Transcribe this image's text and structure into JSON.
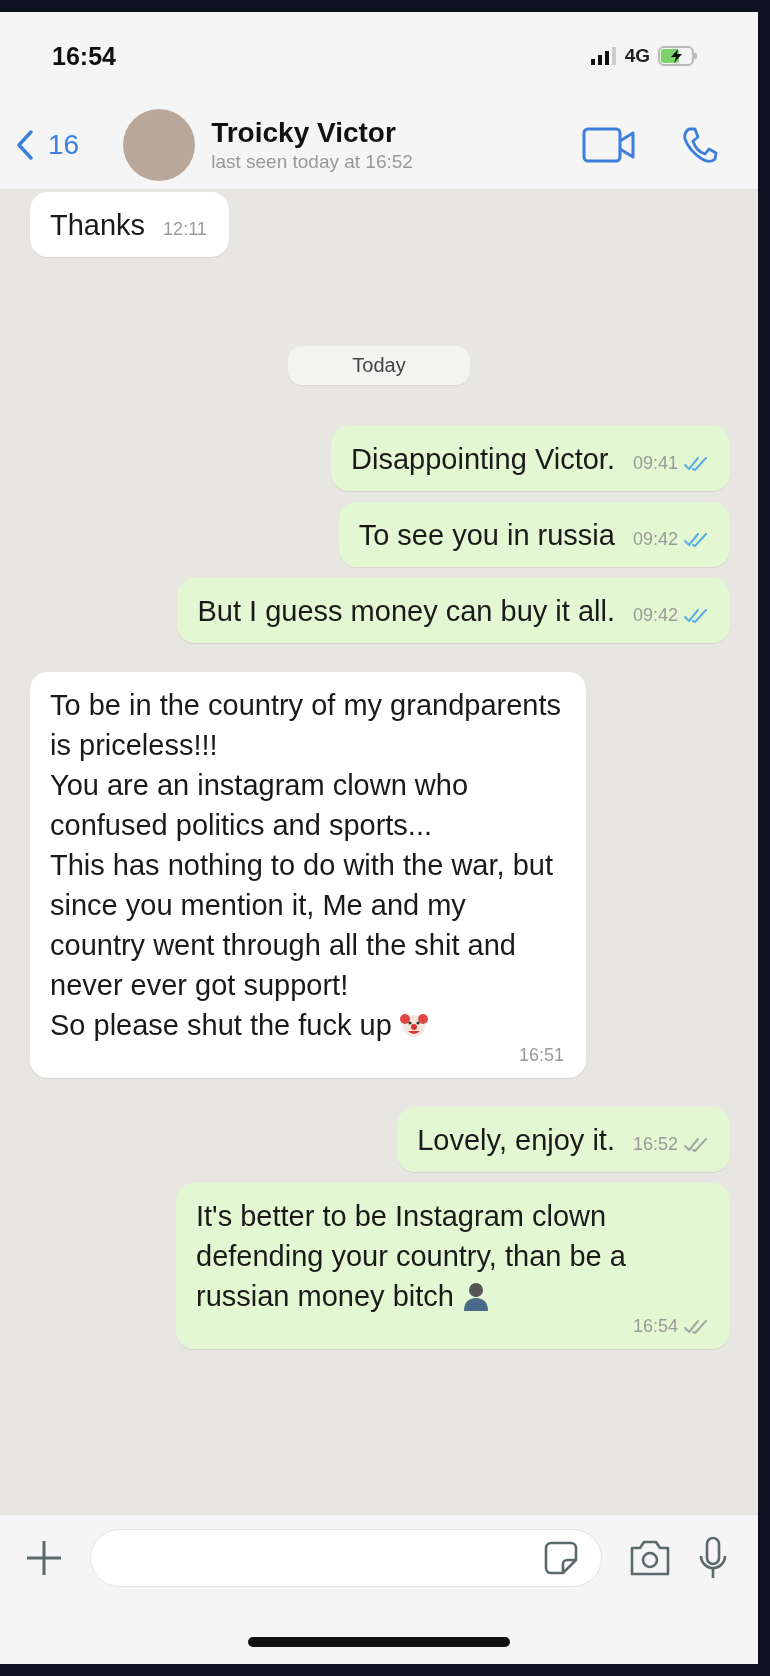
{
  "status_bar": {
    "time": "16:54",
    "network": "4G"
  },
  "header": {
    "back_count": "16",
    "contact_name": "Troicky Victor",
    "last_seen": "last seen today at 16:52"
  },
  "messages": [
    {
      "kind": "incoming",
      "text": "Thanks",
      "time": "12:11"
    },
    {
      "kind": "date",
      "text": "Today"
    },
    {
      "kind": "outgoing",
      "text": "Disappointing Victor.",
      "time": "09:41",
      "read": true
    },
    {
      "kind": "outgoing",
      "text": "To see you in russia",
      "time": "09:42",
      "read": true
    },
    {
      "kind": "outgoing",
      "text": "But I guess money can buy it all.",
      "time": "09:42",
      "read": true
    },
    {
      "kind": "incoming",
      "text": "To be in the country of my grandparents is priceless!!!\nYou are an instagram clown who confused politics and sports...\nThis has nothing to do with the war, but since you mention it, Me and my country went through all the shit and never ever got support!\nSo please shut the fuck up",
      "emoji": {
        "kind": "clown"
      },
      "time": "16:51"
    },
    {
      "kind": "outgoing",
      "text": "Lovely, enjoy it.",
      "time": "16:52",
      "read": false
    },
    {
      "kind": "outgoing",
      "text": "It's better to be Instagram clown defending your country, than be a russian money bitch",
      "emoji": {
        "kind": "person"
      },
      "time": "16:54",
      "read": false
    }
  ]
}
